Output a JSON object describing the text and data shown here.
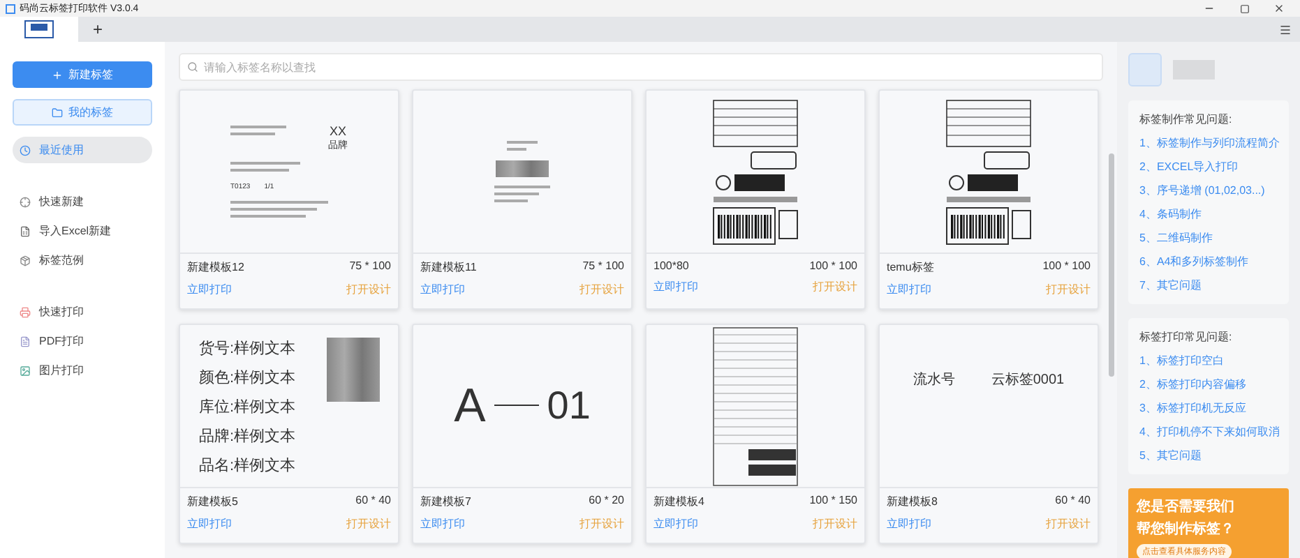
{
  "window": {
    "title": "码尚云标签打印软件 V3.0.4"
  },
  "tab_bar": {
    "add_label": "+"
  },
  "sidebar": {
    "new_button": "新建标签",
    "my_labels_button": "我的标签",
    "groups": [
      [
        {
          "label": "最近使用",
          "selected": true
        }
      ],
      [
        {
          "label": "快速新建",
          "selected": false
        },
        {
          "label": "导入Excel新建",
          "selected": false
        },
        {
          "label": "标签范例",
          "selected": false
        }
      ],
      [
        {
          "label": "快速打印",
          "selected": false
        },
        {
          "label": "PDF打印",
          "selected": false
        },
        {
          "label": "图片打印",
          "selected": false
        }
      ]
    ]
  },
  "search": {
    "placeholder": "请输入标签名称以查找"
  },
  "cards": [
    {
      "name": "新建模板12",
      "size": "75 * 100",
      "print": "立即打印",
      "design": "打开设计",
      "preview": {
        "kind": "food",
        "texts": [
          "XX",
          "品牌",
          "T0123",
          "1/1"
        ]
      }
    },
    {
      "name": "新建模板11",
      "size": "75 * 100",
      "print": "立即打印",
      "design": "打开设计",
      "preview": {
        "kind": "notes"
      }
    },
    {
      "name": "100*80",
      "size": "100 * 100",
      "print": "立即打印",
      "design": "打开设计",
      "preview": {
        "kind": "shipping"
      }
    },
    {
      "name": "temu标签",
      "size": "100 * 100",
      "print": "立即打印",
      "design": "打开设计",
      "preview": {
        "kind": "shipping"
      }
    },
    {
      "name": "新建模板5",
      "size": "60 * 40",
      "print": "立即打印",
      "design": "打开设计",
      "preview": {
        "kind": "fields",
        "texts": [
          "货号:样例文本",
          "颜色:样例文本",
          "库位:样例文本",
          "品牌:样例文本",
          "品名:样例文本"
        ]
      }
    },
    {
      "name": "新建模板7",
      "size": "60 * 20",
      "print": "立即打印",
      "design": "打开设计",
      "preview": {
        "kind": "code",
        "texts": [
          "A",
          "01"
        ]
      }
    },
    {
      "name": "新建模板4",
      "size": "100 * 150",
      "print": "立即打印",
      "design": "打开设计",
      "preview": {
        "kind": "compliance"
      }
    },
    {
      "name": "新建模板8",
      "size": "60 * 40",
      "print": "立即打印",
      "design": "打开设计",
      "preview": {
        "kind": "serial",
        "texts": [
          "流水号",
          "云标签0001"
        ]
      }
    }
  ],
  "help_sections": [
    {
      "title": "标签制作常见问题:",
      "links": [
        "1、标签制作与列印流程简介",
        "2、EXCEL导入打印",
        "3、序号递增 (01,02,03...)",
        "4、条码制作",
        "5、二维码制作",
        "6、A4和多列标签制作",
        "7、其它问题"
      ]
    },
    {
      "title": "标签打印常见问题:",
      "links": [
        "1、标签打印空白",
        "2、标签打印内容偏移",
        "3、标签打印机无反应",
        "4、打印机停不下来如何取消",
        "5、其它问题"
      ]
    }
  ],
  "banner": {
    "headline": [
      "您是否需要我们",
      "帮您制作标签？"
    ],
    "button": "点击查看具体服务内容"
  }
}
